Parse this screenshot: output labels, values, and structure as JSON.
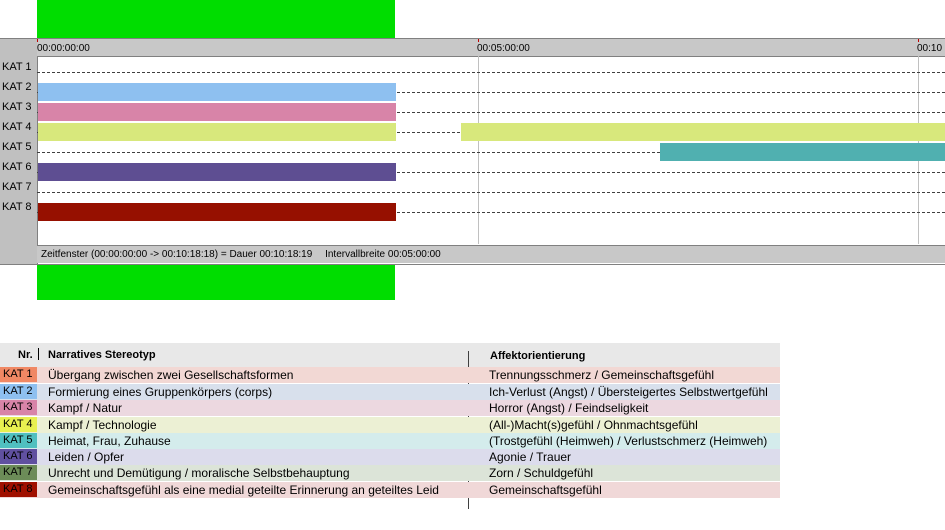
{
  "timeline": {
    "ticks": [
      {
        "label": "00:00:00:00",
        "color": "#c00000"
      },
      {
        "label": "00:05:00:00",
        "color": "#c00000"
      },
      {
        "label": "00:10",
        "color": "#c00000"
      }
    ],
    "rows": [
      {
        "label": "KAT 1"
      },
      {
        "label": "KAT 2"
      },
      {
        "label": "KAT 3"
      },
      {
        "label": "KAT 4"
      },
      {
        "label": "KAT 5"
      },
      {
        "label": "KAT 6"
      },
      {
        "label": "KAT 7"
      },
      {
        "label": "KAT 8"
      }
    ],
    "bars": [
      {
        "row": 1,
        "color": "#8ec0f0"
      },
      {
        "row": 2,
        "color": "#d884a8"
      },
      {
        "row": 3,
        "color": "#d8e87c"
      },
      {
        "row": 3,
        "color": "#d8e87c"
      },
      {
        "row": 4,
        "color": "#50b0b0"
      },
      {
        "row": 5,
        "color": "#5e4e92"
      },
      {
        "row": 7,
        "color": "#961000"
      }
    ],
    "status": {
      "zeitfenster": "Zeitfenster (00:00:00:00 -> 00:10:18:18) = Dauer 00:10:18:19",
      "intervall": "Intervallbreite 00:05:00:00"
    }
  },
  "legend": {
    "header": {
      "nr": "Nr.",
      "stereotyp": "Narratives Stereotyp",
      "affekt": "Affektorientierung"
    },
    "rows": [
      {
        "kat": "KAT 1",
        "color": "#f08864",
        "bg": "#f2d8d4",
        "stereotyp": "Übergang zwischen zwei Gesellschaftsformen",
        "affekt": "Trennungsschmerz / Gemeinschaftsgefühl"
      },
      {
        "kat": "KAT 2",
        "color": "#8ec0f0",
        "bg": "#d8e0ec",
        "stereotyp": "Formierung eines Gruppenkörpers (corps)",
        "affekt": "Ich-Verlust (Angst) / Übersteigertes Selbstwertgefühl"
      },
      {
        "kat": "KAT 3",
        "color": "#d884a8",
        "bg": "#ecd8e0",
        "stereotyp": "Kampf / Natur",
        "affekt": "Horror (Angst) / Feindseligkeit"
      },
      {
        "kat": "KAT 4",
        "color": "#e8f050",
        "bg": "#ecf0d4",
        "stereotyp": "Kampf / Technologie",
        "affekt": "(All-)Macht(s)gefühl / Ohnmachtsgefühl"
      },
      {
        "kat": "KAT 5",
        "color": "#50c0c0",
        "bg": "#d4ecec",
        "stereotyp": "Heimat, Frau, Zuhause",
        "affekt": "(Trostgefühl (Heimweh) / Verlustschmerz (Heimweh)"
      },
      {
        "kat": "KAT 6",
        "color": "#6050a0",
        "bg": "#dcdcec",
        "stereotyp": "Leiden / Opfer",
        "affekt": "Agonie / Trauer"
      },
      {
        "kat": "KAT 7",
        "color": "#6c8c58",
        "bg": "#dce4d8",
        "stereotyp": "Unrecht und Demütigung / moralische Selbstbehauptung",
        "affekt": "Zorn / Schuldgefühl"
      },
      {
        "kat": "KAT 8",
        "color": "#a01000",
        "bg": "#f0d8d8",
        "stereotyp": "Gemeinschaftsgefühl als eine medial geteilte Erinnerung an geteiltes Leid",
        "affekt": "Gemeinschaftsgefühl"
      }
    ]
  }
}
